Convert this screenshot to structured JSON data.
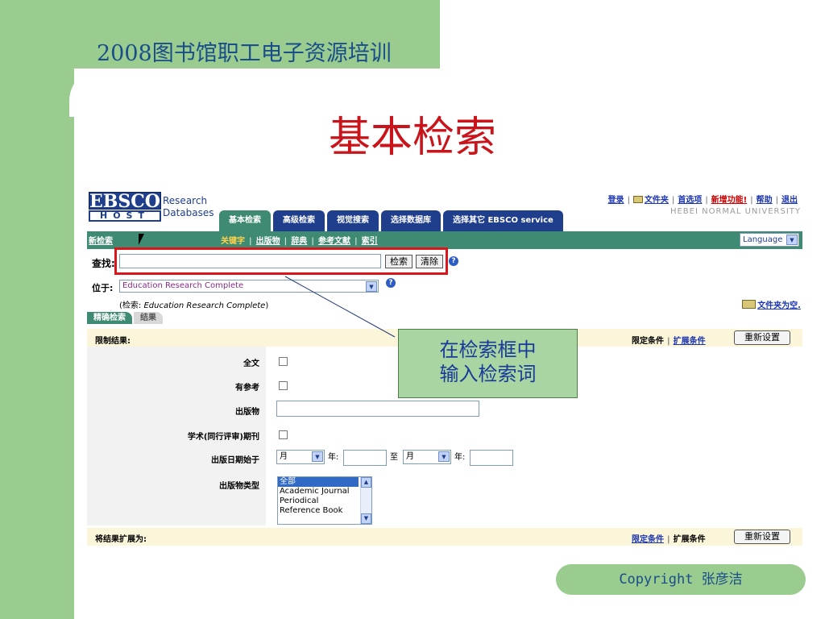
{
  "slide": {
    "header_title": "2008图书馆职工电子资源培训",
    "main_title": "基本检索",
    "callout_line1": "在检索框中",
    "callout_line2": "输入检索词",
    "copyright": "Copyright  张彦洁"
  },
  "ebsco": {
    "logo_top": "EBSCO",
    "logo_bottom": "HOST",
    "brand_line1": "Research",
    "brand_line2": "Databases",
    "tabs": [
      {
        "label": "基本检索",
        "active": true
      },
      {
        "label": "高级检索"
      },
      {
        "label": "视觉搜索"
      },
      {
        "label": "选择数据库"
      },
      {
        "label": "选择其它 EBSCO service"
      }
    ],
    "top_links": {
      "login": "登录",
      "folder": "文件夹",
      "preferences": "首选项",
      "new_features": "新增功能!",
      "help": "帮助",
      "exit": "退出"
    },
    "university": "HEBEI NORMAL UNIVERSITY",
    "toolbar": {
      "new_search": "新检索",
      "keyword": "关键字",
      "publications": "出版物",
      "dictionary": "辞典",
      "references": "参考文献",
      "index": "索引",
      "language": "Language"
    },
    "search": {
      "find_label": "查找:",
      "find_value": "",
      "search_button": "检索",
      "clear_button": "清除",
      "help_icon": "?"
    },
    "location": {
      "label": "位于:",
      "selected": "Education Research Complete",
      "searching_prefix": "(检索: ",
      "searching_db": "Education Research Complete",
      "searching_suffix": ")",
      "folder_empty": "文件夹为空."
    },
    "subtabs": [
      {
        "label": "精确检索",
        "active": true
      },
      {
        "label": "结果",
        "active": false
      }
    ],
    "limit": {
      "title": "限制结果:",
      "limiters": "限定条件",
      "expanders": "扩展条件",
      "reset": "重新设置"
    },
    "fields": {
      "full_text": "全文",
      "references": "有参考",
      "publication": "出版物",
      "peer_reviewed": "学术(同行评审)期刊",
      "pub_date": "出版日期始于",
      "month": "月",
      "year": "年:",
      "to": "至",
      "pub_type": "出版物类型",
      "pub_types": [
        "全部",
        "Academic Journal",
        "Periodical",
        "Reference Book"
      ]
    },
    "expand": {
      "title": "将结果扩展为:",
      "limiters": "限定条件",
      "expanders": "扩展条件",
      "reset": "重新设置"
    }
  }
}
